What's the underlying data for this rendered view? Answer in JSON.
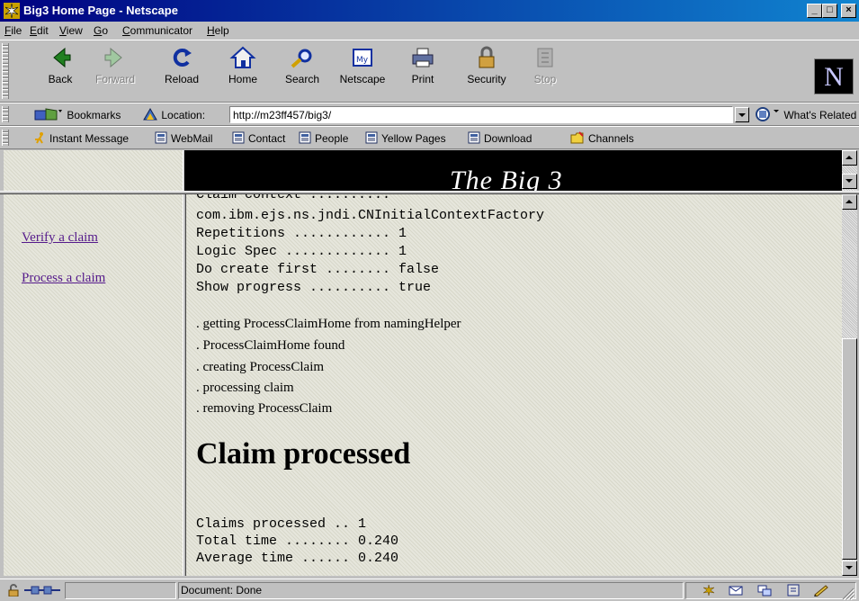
{
  "window": {
    "title": "Big3 Home Page - Netscape",
    "min": "_",
    "max": "□",
    "close": "×"
  },
  "menu": [
    {
      "key": "F",
      "rest": "ile"
    },
    {
      "key": "E",
      "rest": "dit"
    },
    {
      "key": "V",
      "rest": "iew"
    },
    {
      "key": "G",
      "rest": "o"
    },
    {
      "key": "C",
      "rest": "ommunicator"
    },
    {
      "key": "H",
      "rest": "elp"
    }
  ],
  "toolbar": {
    "back": "Back",
    "forward": "Forward",
    "reload": "Reload",
    "home": "Home",
    "search": "Search",
    "netscape": "Netscape",
    "print": "Print",
    "security": "Security",
    "stop": "Stop",
    "logo": "N"
  },
  "location": {
    "bookmarks": "Bookmarks",
    "label": "Location:",
    "url": "http://m23ff457/big3/",
    "whats_related": "What's Related"
  },
  "personal": {
    "instant_message": "Instant Message",
    "webmail": "WebMail",
    "contact": "Contact",
    "people": "People",
    "yellow_pages": "Yellow Pages",
    "download": "Download",
    "channels": "Channels"
  },
  "banner": {
    "title": "The Big 3"
  },
  "left_nav": {
    "verify": "Verify a claim",
    "process": "Process a claim"
  },
  "main": {
    "cut_line": "Claim context ..........",
    "config": [
      "com.ibm.ejs.ns.jndi.CNInitialContextFactory",
      "Repetitions ............ 1",
      "Logic Spec ............. 1",
      "Do create first ........ false",
      "Show progress .......... true"
    ],
    "steps": [
      ". getting ProcessClaimHome from namingHelper",
      ". ProcessClaimHome found",
      ". creating ProcessClaim",
      ". processing claim",
      ". removing ProcessClaim"
    ],
    "heading": "Claim processed",
    "summary": [
      "Claims processed .. 1",
      "Total time ........ 0.240",
      "Average time ...... 0.240"
    ]
  },
  "status": {
    "text": "Document: Done"
  }
}
